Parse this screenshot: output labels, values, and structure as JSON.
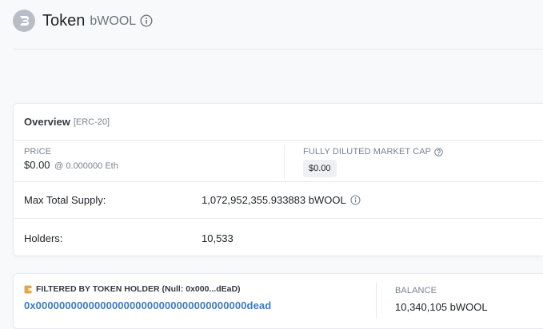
{
  "header": {
    "title": "Token",
    "symbol": "bWOOL",
    "logo_icon": "bscscan-logo-icon",
    "info_icon": "info-circle-icon"
  },
  "overview": {
    "title": "Overview",
    "subtitle": "[ERC-20]",
    "price": {
      "label": "PRICE",
      "value": "$0.00",
      "eth": "@ 0.000000 Eth"
    },
    "market_cap": {
      "label": "FULLY DILUTED MARKET CAP",
      "value": "$0.00",
      "help_icon": "question-circle-icon"
    },
    "max_supply": {
      "label": "Max Total Supply:",
      "value": "1,072,952,355.933883 bWOOL",
      "info_icon": "info-circle-icon"
    },
    "holders": {
      "label": "Holders:",
      "value": "10,533"
    }
  },
  "filter": {
    "label": "FILTERED BY TOKEN HOLDER (Null: 0x000...dEaD)",
    "address": "0x000000000000000000000000000000000000dead",
    "wallet_icon": "wallet-icon",
    "balance_label": "BALANCE",
    "balance_value": "10,340,105 bWOOL"
  },
  "colors": {
    "link": "#3d7bbf",
    "wallet_icon": "#e0a84a",
    "border": "#e7eaf3",
    "muted": "#77838f"
  }
}
